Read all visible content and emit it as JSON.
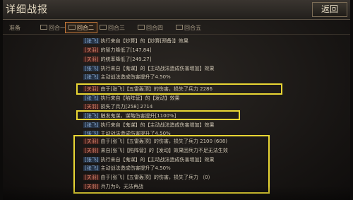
{
  "header": {
    "title": "详细战报",
    "back_label": "返回"
  },
  "tabs": [
    {
      "label": "准备"
    },
    {
      "label": "回合一"
    },
    {
      "label": "回合二"
    },
    {
      "label": "回合三"
    },
    {
      "label": "回合四"
    },
    {
      "label": "回合五"
    }
  ],
  "log": [
    {
      "tag": "[张飞]",
      "text": "执行来自【妙算】的【妙算[预备]】效果"
    },
    {
      "tag": "[关羽]",
      "text": "的智力降低了[147.84]"
    },
    {
      "tag": "[关羽]",
      "text": "的统率降低了[249.27]"
    },
    {
      "tag": "[张飞]",
      "text": "执行来自【鬼谋】的【主动战法造成伤害增加】效果"
    },
    {
      "tag": "[张飞]",
      "text": "主动战法造成伤害提升了4.50%"
    },
    {
      "tag": "[关羽]",
      "text": "由于[张飞]【五雷轰顶】的伤害，损失了兵力 2286"
    },
    {
      "tag": "[张飞]",
      "text": "执行来自【陷阵营】的【发动】效果"
    },
    {
      "tag": "[关羽]",
      "text": "损失了兵力[258] 2714"
    },
    {
      "tag": "[张飞]",
      "text": "触发鬼谋，谋略伤害提升[1100%]"
    },
    {
      "tag": "[张飞]",
      "text": "执行来自【鬼谋】的【主动战法造成伤害增加】效果"
    },
    {
      "tag": "[张飞]",
      "text": "主动战法造成伤害提升了4.50%"
    },
    {
      "tag": "[关羽]",
      "text": "由于[张飞]【五雷轰顶】的伤害，损失了兵力 2100 (608)"
    },
    {
      "tag": "[关羽]",
      "text": "来自[张飞]【陷阵营】的【发动】效果因兵力不足无法生效"
    },
    {
      "tag": "[张飞]",
      "text": "执行来自【鬼谋】的【主动战法造成伤害增加】效果"
    },
    {
      "tag": "[张飞]",
      "text": "主动战法造成伤害提升了4.50%"
    },
    {
      "tag": "[关羽]",
      "text": "由于[张飞]【五雷轰顶】的伤害，损失了兵力 （0）"
    },
    {
      "tag": "[关羽]",
      "text": "兵力为0，无法再战"
    }
  ]
}
